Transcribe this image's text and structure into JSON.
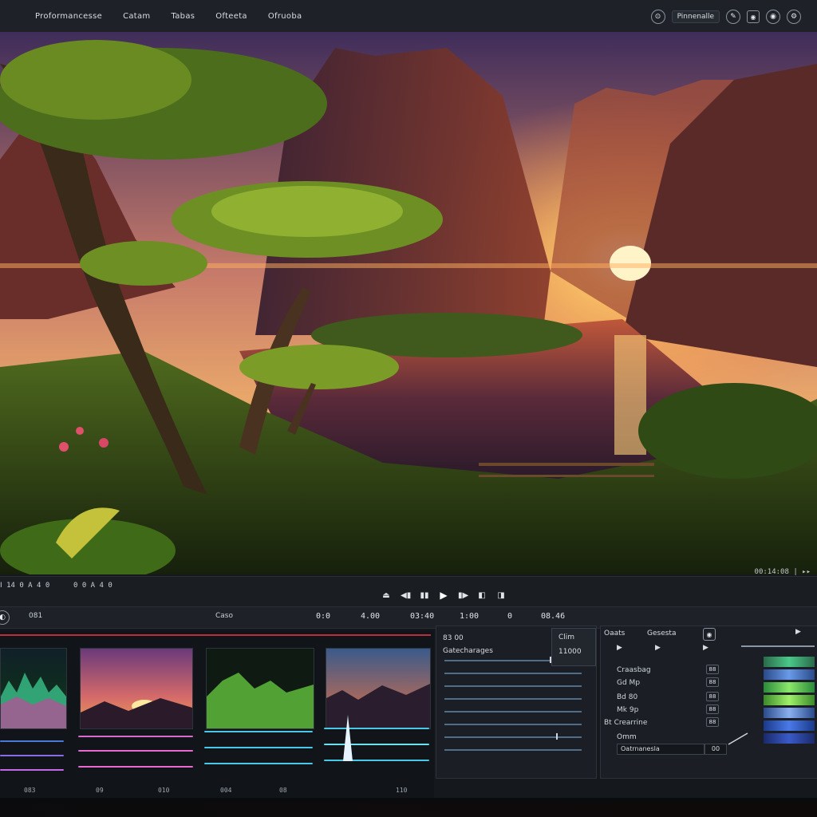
{
  "menu": {
    "items": [
      "Proformancesse",
      "Catam",
      "Tabas",
      "Ofteeta",
      "Ofruoba"
    ]
  },
  "top_right": {
    "label": "Pinnenalle",
    "buttons": [
      "⊙",
      "✎",
      "◉",
      "◉",
      "⚙"
    ]
  },
  "viewer": {
    "timecode_right": "00:14:08 | ▸▸",
    "timecode_left": "Ⅰ 14 0 A 4 0",
    "timecode_left2": "0 0 A 4 0"
  },
  "transport": {
    "buttons": [
      "⏏",
      "◀▮",
      "▮▮",
      "▶",
      "▮▶",
      "◧",
      "◨"
    ]
  },
  "timeline_header": {
    "clip_label": "081",
    "track_label": "Caso",
    "time1": "0:0",
    "time2": "4.00",
    "time3": "03:40",
    "time4": "1:00",
    "time5": "0",
    "time6": "08.46"
  },
  "clips": {
    "labels": [
      "083",
      "09",
      "010",
      "08",
      "004",
      "110"
    ]
  },
  "mid_panel": {
    "title": "83 00",
    "subtitle": "Gatecharages",
    "popup_line1": "Clim",
    "popup_line2": "11000"
  },
  "right_panel": {
    "header_left": "Oaats",
    "header_mid": "Gesesta",
    "row_labels": [
      "Craasbag",
      "Gd Mp",
      "Bd 80",
      "Mk 9p",
      "Bt Crearrine"
    ],
    "row_buttons": [
      "88",
      "88",
      "88",
      "88",
      "88"
    ],
    "bottom_label": "Omm",
    "field1": "Oatrnanesla",
    "field2": "00"
  },
  "colors": {
    "accent_red": "#b8323b",
    "panel_bg": "#1b1f25",
    "track_blue": "#4c6e8a"
  }
}
